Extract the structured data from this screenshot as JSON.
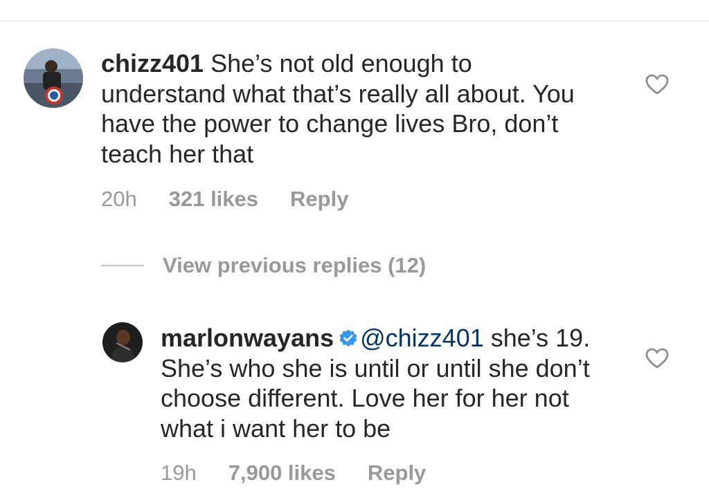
{
  "comments": [
    {
      "username": "chizz401",
      "text": " She’s not old enough to understand what that’s really all about. You have the power to change lives Bro, don’t teach her that",
      "time": "20h",
      "likes": "321 likes",
      "reply_label": "Reply"
    }
  ],
  "replies_toggle": {
    "label": "View previous replies (12)"
  },
  "reply": {
    "username": "marlonwayans",
    "verified_icon": "verified-badge-icon",
    "mention": "@chizz401",
    "text": " she’s 19. She’s who she is until or until she don’t choose different. Love her for her not what i want her to be",
    "time": "19h",
    "likes": "7,900 likes",
    "reply_label": "Reply"
  },
  "colors": {
    "text": "#262626",
    "muted": "#999999",
    "mention": "#003569",
    "verified": "#3897f0"
  }
}
